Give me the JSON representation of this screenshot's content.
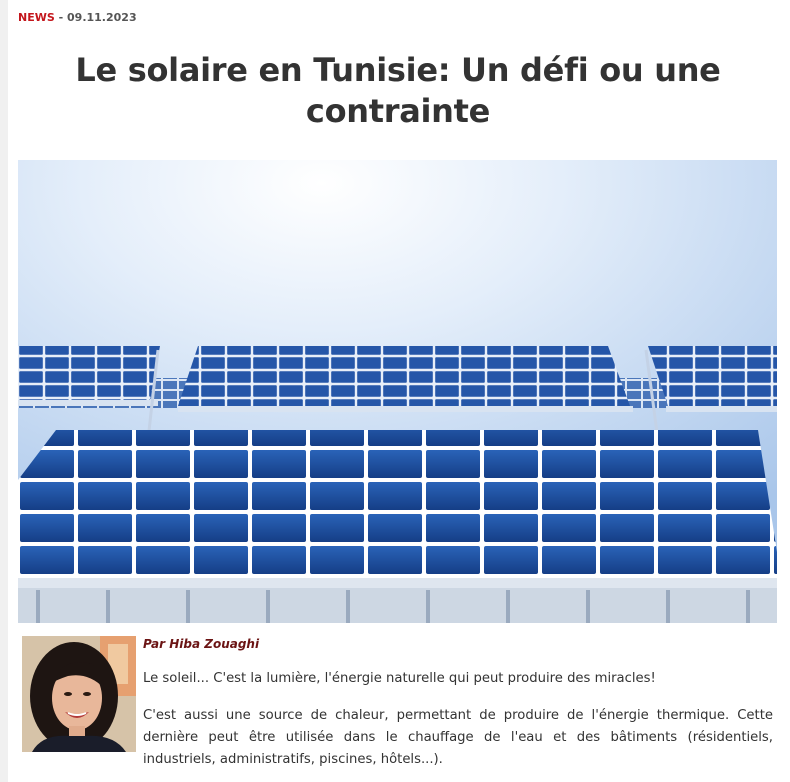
{
  "article": {
    "category": "NEWS",
    "separator": " - ",
    "date": "09.11.2023",
    "title": "Le solaire en Tunisie: Un défi ou une contrainte",
    "byline": "Par Hiba Zouaghi",
    "paragraphs": [
      "Le soleil... C'est la lumière, l'énergie naturelle qui peut produire des miracles!",
      "C'est aussi une source de chaleur, permettant de produire de l'énergie thermique. Cette dernière peut être utilisée dans le chauffage de l'eau et des bâtiments (résidentiels, industriels, administratifs, piscines, hôtels...)."
    ]
  },
  "colors": {
    "category_red": "#c4161c",
    "byline_maroon": "#6b1414",
    "text": "#333333",
    "panel_blue": "#1f4f9e",
    "sky": "#c9dcf2"
  },
  "images": {
    "hero": "solar-panels-photo",
    "author": "author-portrait-photo"
  }
}
